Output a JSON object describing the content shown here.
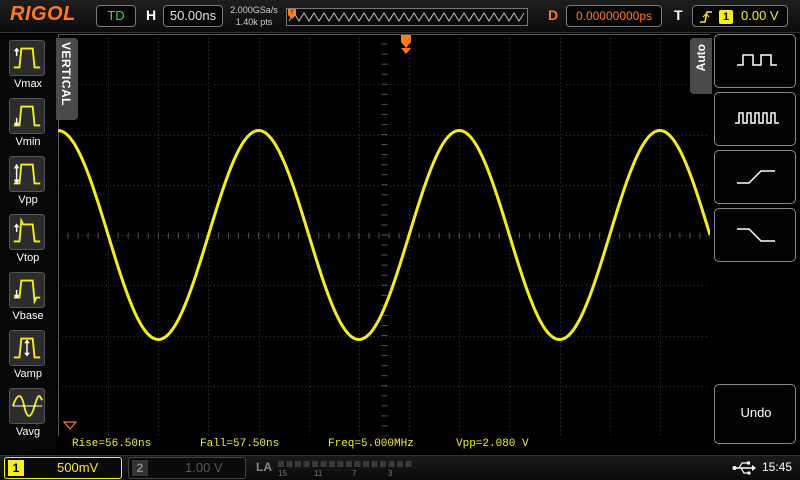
{
  "brand": "RIGOL",
  "top": {
    "trigger_status": "TD",
    "horizontal_label": "H",
    "timebase": "50.00ns",
    "sample_rate": "2.000GSa/s",
    "memory_depth": "1.40k pts",
    "delay_label": "D",
    "delay": "0.00000000ps",
    "trigger_label": "T",
    "trigger_source": "1",
    "trigger_level": "0.00 V",
    "trigger_edge_icon": "rising-edge-icon"
  },
  "left_panel": {
    "tab_label": "VERTICAL",
    "items": [
      {
        "label": "Vmax",
        "icon": "vmax-icon"
      },
      {
        "label": "Vmin",
        "icon": "vmin-icon"
      },
      {
        "label": "Vpp",
        "icon": "vpp-icon"
      },
      {
        "label": "Vtop",
        "icon": "vtop-icon"
      },
      {
        "label": "Vbase",
        "icon": "vbase-icon"
      },
      {
        "label": "Vamp",
        "icon": "vamp-icon"
      },
      {
        "label": "Vavg",
        "icon": "vavg-icon"
      }
    ]
  },
  "right_panel": {
    "tab_label": "Auto",
    "buttons": [
      {
        "icon": "single-period-pulse-icon"
      },
      {
        "icon": "multi-period-pulse-icon"
      },
      {
        "icon": "rising-edge-icon"
      },
      {
        "icon": "falling-edge-icon"
      }
    ],
    "undo_label": "Undo"
  },
  "measurements": {
    "rise": "Rise=56.50ns",
    "fall": "Fall=57.50ns",
    "freq": "Freq=5.000MHz",
    "vpp": "Vpp=2.080 V"
  },
  "bottom": {
    "ch1_number": "1",
    "ch1_scale": "500mV",
    "ch2_number": "2",
    "ch2_scale": "1.00 V",
    "la_label": "LA",
    "la_numbers": [
      "15",
      "11",
      "7",
      "3"
    ],
    "time": "15:45"
  },
  "colors": {
    "ch1": "#f4ef1a",
    "accent": "#ff7a1a",
    "trigger_status": "#3ddc3d"
  },
  "waveform": {
    "type": "sine",
    "frequency_mhz": 5.0,
    "amplitude_v": 1.04,
    "volts_per_div": 0.5,
    "time_per_div_ns": 50
  }
}
